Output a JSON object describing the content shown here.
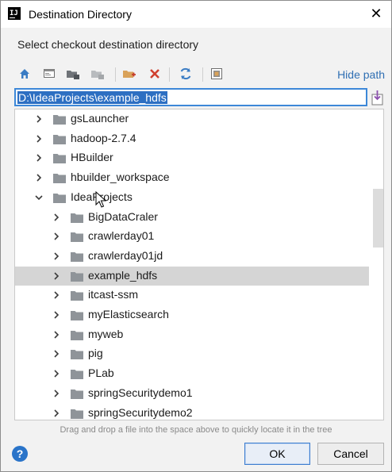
{
  "window": {
    "title": "Destination Directory",
    "app_icon": "IJ",
    "close_glyph": "✕"
  },
  "subtitle": "Select checkout destination directory",
  "toolbar": {
    "icons": [
      "home-icon",
      "desktop-icon",
      "project-dir-icon",
      "module-dir-icon",
      "new-folder-icon",
      "delete-icon",
      "refresh-icon",
      "show-hidden-icon"
    ],
    "hide_path": "Hide path"
  },
  "path": {
    "value": "D:\\IdeaProjects\\example_hdfs"
  },
  "tree": {
    "items": [
      {
        "label": "gsLauncher",
        "level": 1,
        "expanded": false,
        "selected": false
      },
      {
        "label": "hadoop-2.7.4",
        "level": 1,
        "expanded": false,
        "selected": false
      },
      {
        "label": "HBuilder",
        "level": 1,
        "expanded": false,
        "selected": false
      },
      {
        "label": "hbuilder_workspace",
        "level": 1,
        "expanded": false,
        "selected": false
      },
      {
        "label": "IdeaProjects",
        "level": 1,
        "expanded": true,
        "selected": false
      },
      {
        "label": "BigDataCraler",
        "level": 2,
        "expanded": false,
        "selected": false
      },
      {
        "label": "crawlerday01",
        "level": 2,
        "expanded": false,
        "selected": false
      },
      {
        "label": "crawlerday01jd",
        "level": 2,
        "expanded": false,
        "selected": false
      },
      {
        "label": "example_hdfs",
        "level": 2,
        "expanded": false,
        "selected": true
      },
      {
        "label": "itcast-ssm",
        "level": 2,
        "expanded": false,
        "selected": false
      },
      {
        "label": "myElasticsearch",
        "level": 2,
        "expanded": false,
        "selected": false
      },
      {
        "label": "myweb",
        "level": 2,
        "expanded": false,
        "selected": false
      },
      {
        "label": "pig",
        "level": 2,
        "expanded": false,
        "selected": false
      },
      {
        "label": "PLab",
        "level": 2,
        "expanded": false,
        "selected": false
      },
      {
        "label": "springSecuritydemo1",
        "level": 2,
        "expanded": false,
        "selected": false
      },
      {
        "label": "springSecuritydemo2",
        "level": 2,
        "expanded": false,
        "selected": false
      }
    ]
  },
  "hint": "Drag and drop a file into the space above to quickly locate it in the tree",
  "buttons": {
    "help": "?",
    "ok": "OK",
    "cancel": "Cancel"
  },
  "colors": {
    "accent": "#2d6fc2",
    "link": "#2f6fb3",
    "selected_row": "#d5d5d5",
    "folder": "#8f9499"
  }
}
